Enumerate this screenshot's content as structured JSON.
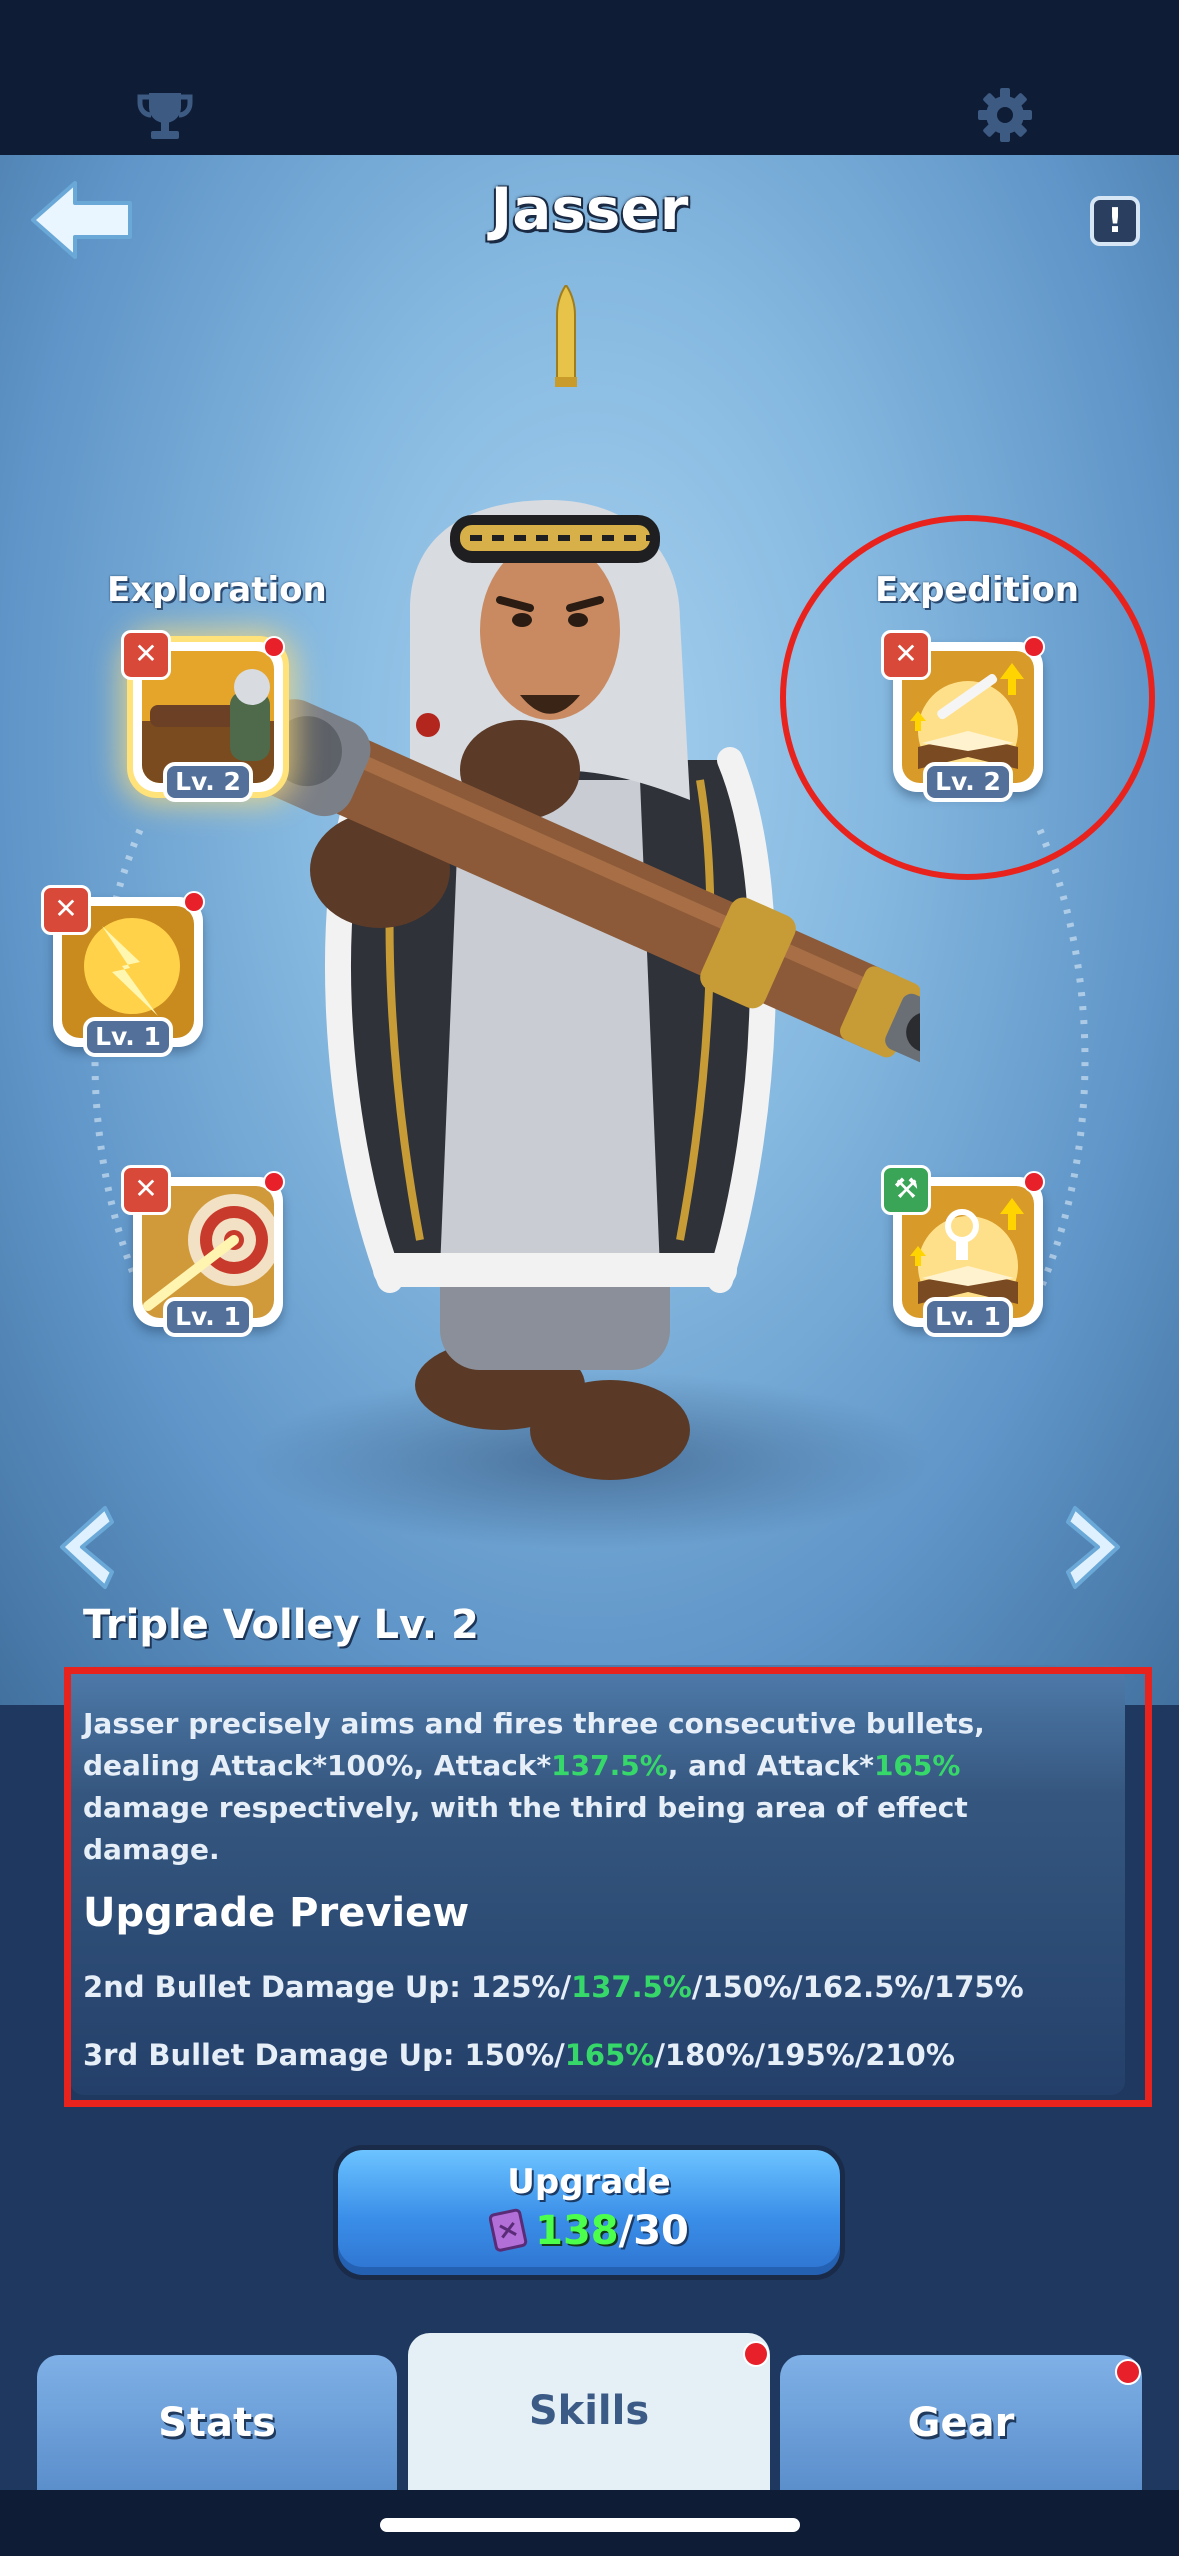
{
  "hero": {
    "name": "Jasser"
  },
  "skill_groups": {
    "exploration": "Exploration",
    "expedition": "Expedition"
  },
  "skills": [
    {
      "id": "triple-volley",
      "level": "Lv. 2",
      "tag": "attack",
      "group": "Exploration",
      "selected": true
    },
    {
      "id": "expedition-rifle-book",
      "level": "Lv. 2",
      "tag": "attack",
      "group": "Expedition"
    },
    {
      "id": "lightning-shot",
      "level": "Lv. 1",
      "tag": "attack"
    },
    {
      "id": "target-shot",
      "level": "Lv. 1",
      "tag": "attack"
    },
    {
      "id": "research-book",
      "level": "Lv. 1",
      "tag": "build"
    }
  ],
  "selected_skill": {
    "title": "Triple Volley Lv. 2",
    "description": {
      "p1": "Jasser precisely aims and fires three consecutive bullets, dealing Attack*100%, Attack*",
      "v1": "137.5%",
      "p2": ", and Attack*",
      "v2": "165%",
      "p3": " damage respectively, with the third being area of effect damage."
    },
    "preview_title": "Upgrade Preview",
    "preview_lines": [
      {
        "prefix": "2nd Bullet Damage Up: 125%/",
        "current": "137.5%",
        "suffix": "/150%/162.5%/175%"
      },
      {
        "prefix": "3rd Bullet Damage Up: 150%/",
        "current": "165%",
        "suffix": "/180%/195%/210%"
      }
    ]
  },
  "upgrade": {
    "label": "Upgrade",
    "have": "138",
    "need": "/30"
  },
  "tabs": [
    "Stats",
    "Skills",
    "Gear"
  ],
  "active_tab": "Skills",
  "colors": {
    "highlight": "#37d86a",
    "annotation_red": "#e8231d",
    "notify_dot": "#e7202a"
  },
  "icons": {
    "top_left": "trophy-icon",
    "top_right": "gear-icon",
    "back": "back-arrow-icon",
    "info": "info-icon",
    "prev": "chevron-left-icon",
    "next": "chevron-right-icon",
    "cost": "skill-book-icon"
  }
}
